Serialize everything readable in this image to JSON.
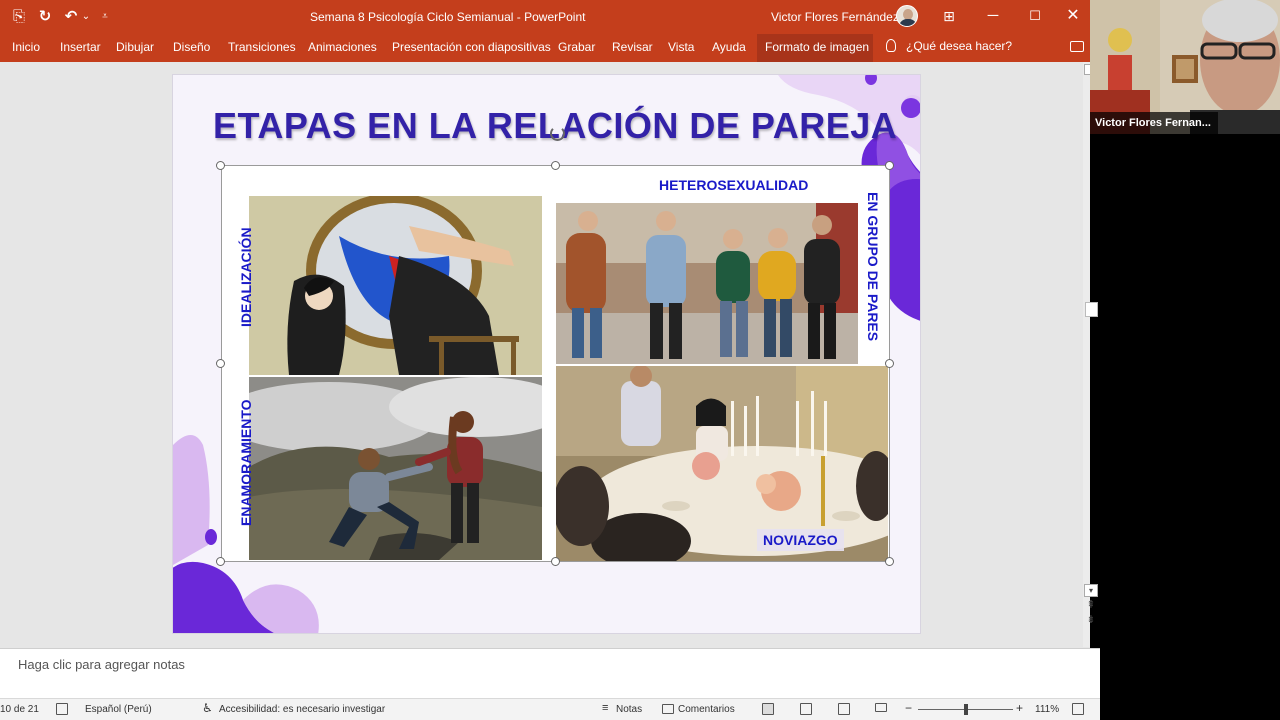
{
  "window": {
    "doc_title": "Semana 8 Psicología Ciclo Semianual  -  PowerPoint",
    "user_name": "Victor Flores Fernández",
    "min_glyph": "─",
    "max_glyph": "☐",
    "close_glyph": "✕",
    "ribbon_display_glyph": "⊞"
  },
  "quick_access": {
    "autosave_glyph": "⎘",
    "redo_glyph": "↻",
    "undo_glyph": "↶",
    "undo_dropdown_glyph": "⌄",
    "customize_glyph": "⩡"
  },
  "ribbon": {
    "tabs": [
      "Inicio",
      "Insertar",
      "Dibujar",
      "Diseño",
      "Transiciones",
      "Animaciones",
      "Presentación con diapositivas",
      "Grabar",
      "Revisar",
      "Vista",
      "Ayuda"
    ],
    "active_tab": "Formato de imagen",
    "tell_me": "¿Qué desea hacer?"
  },
  "slide": {
    "title": "ETAPAS EN LA RELACIÓN DE PAREJA",
    "labels": {
      "idealizacion": "IDEALIZACIÓN",
      "enamoramiento": "ENAMORAMIENTO",
      "heterosexualidad": "HETEROSEXUALIDAD",
      "grupo_pares": "EN GRUPO DE PARES",
      "noviazgo": "NOVIAZGO"
    },
    "colors": {
      "accent": "#1a1ac8",
      "title": "#3322a8",
      "blob_dark": "#6a28d8",
      "blob_light": "#d9b8f0"
    }
  },
  "notes": {
    "placeholder": "Haga clic para agregar notas"
  },
  "status": {
    "slide_counter": "10 de 21",
    "language": "Español (Perú)",
    "accessibility": "Accesibilidad: es necesario investigar",
    "notes": "Notas",
    "comments": "Comentarios",
    "zoom_out": "−",
    "zoom_in": "+",
    "zoom": "111%"
  },
  "scrollbar": {
    "down_glyph": "▾",
    "prev_glyph": "⇞",
    "next_glyph": "⇟"
  },
  "video": {
    "participant": "Victor Flores Fernan..."
  }
}
